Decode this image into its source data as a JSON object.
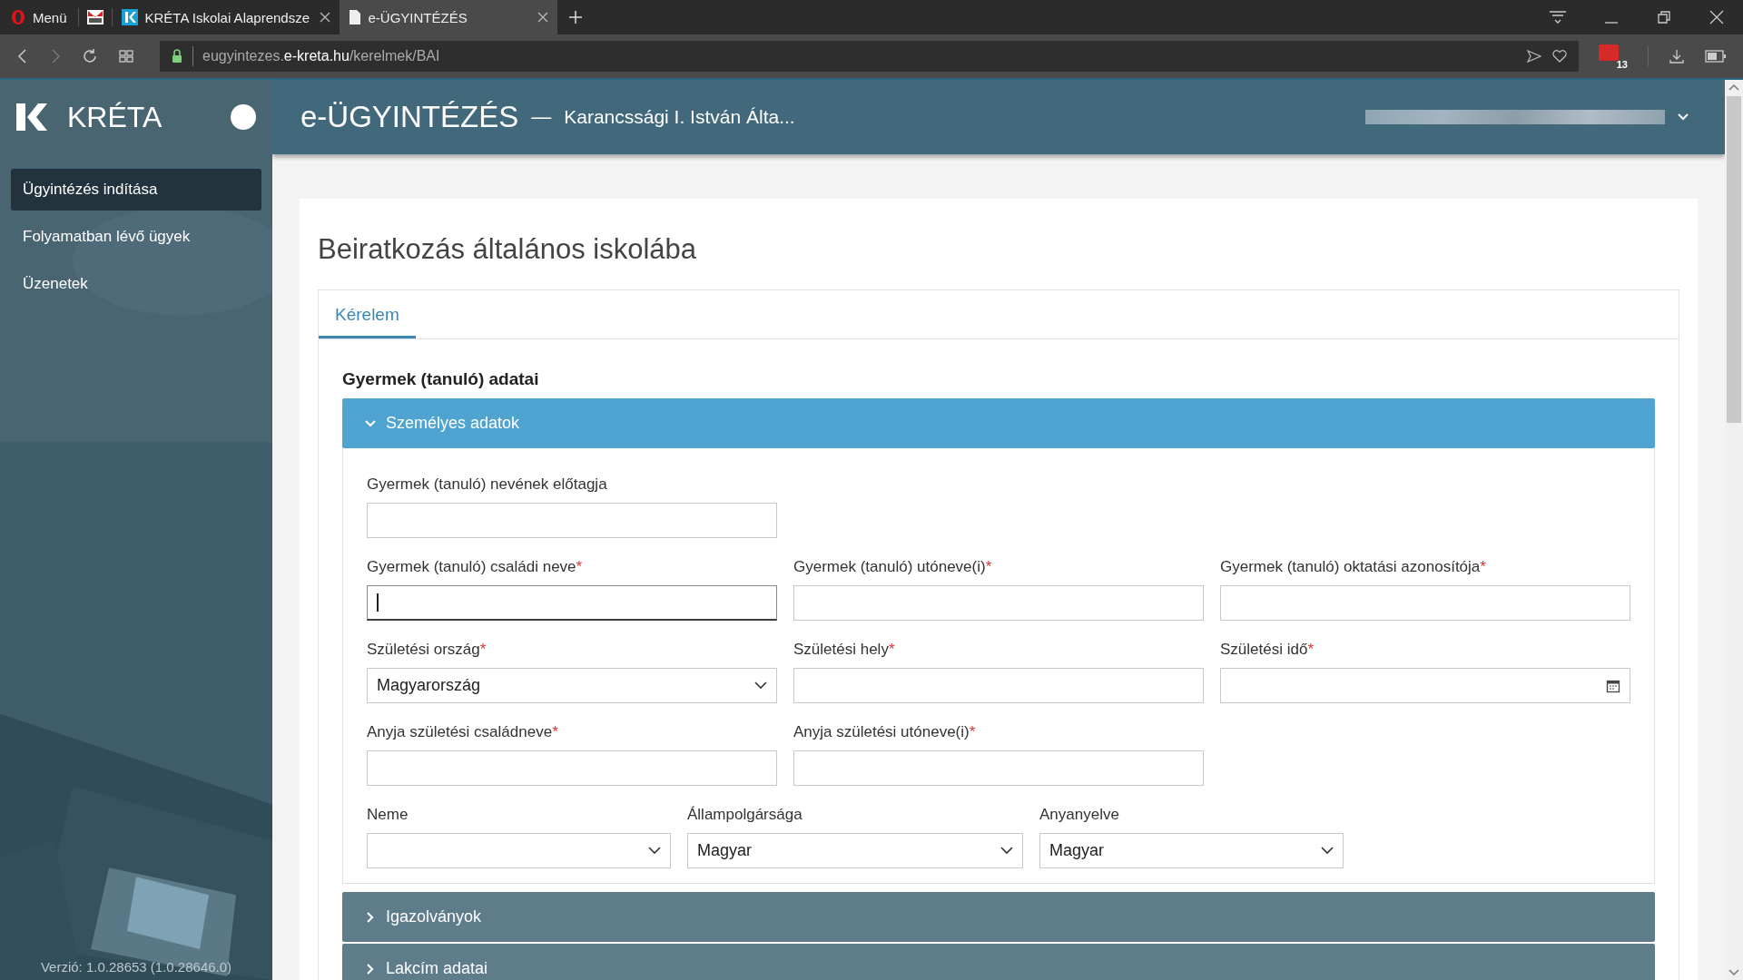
{
  "browser": {
    "menu": "Menü",
    "tabs": [
      {
        "kind": "pinned",
        "selected": false
      },
      {
        "label": "KRÉTA Iskolai Alaprendsze",
        "kind": "kreta",
        "selected": false
      },
      {
        "label": "e-ÜGYINTÉZÉS",
        "kind": "page",
        "selected": true
      }
    ],
    "url": {
      "prefix": "eugyintezes.",
      "domain": "e-kreta.hu",
      "path": "/kerelmek/BAI"
    },
    "badge": "13"
  },
  "sidebar": {
    "brand": "KRÉTA",
    "items": [
      {
        "label": "Ügyintézés indítása",
        "selected": true
      },
      {
        "label": "Folyamatban lévő ügyek",
        "selected": false
      },
      {
        "label": "Üzenetek",
        "selected": false
      }
    ],
    "version": "Verzió: 1.0.28653 (1.0.28646.0)"
  },
  "header": {
    "title": "e-ÜGYINTÉZÉS",
    "separator": "—",
    "school": "Karancssági I. István Álta..."
  },
  "page": {
    "title": "Beiratkozás általános iskolába",
    "tabs": [
      {
        "label": "Kérelem",
        "selected": true
      }
    ],
    "section_title": "Gyermek (tanuló) adatai",
    "required_mark": "*",
    "accordions": [
      {
        "title": "Személyes adatok",
        "expanded": true,
        "rows": [
          {
            "kind": "thirds",
            "fields": [
              {
                "label": "Gyermek (tanuló) nevének előtagja",
                "required": false,
                "kind": "text",
                "focused": false
              }
            ]
          },
          {
            "kind": "thirds",
            "fields": [
              {
                "label": "Gyermek (tanuló) családi neve",
                "required": true,
                "kind": "text",
                "focused": true
              },
              {
                "label": "Gyermek (tanuló) utóneve(i)",
                "required": true,
                "kind": "text",
                "focused": false
              },
              {
                "label": "Gyermek (tanuló) oktatási azonosítója",
                "required": true,
                "kind": "text",
                "focused": false
              }
            ]
          },
          {
            "kind": "thirds",
            "fields": [
              {
                "label": "Születési ország",
                "required": true,
                "kind": "select",
                "value": "Magyarország",
                "focused": false
              },
              {
                "label": "Születési hely",
                "required": true,
                "kind": "text",
                "focused": false
              },
              {
                "label": "Születési idő",
                "required": true,
                "kind": "date",
                "focused": false
              }
            ]
          },
          {
            "kind": "thirds",
            "fields": [
              {
                "label": "Anyja születési családneve",
                "required": true,
                "kind": "text",
                "focused": false
              },
              {
                "label": "Anyja születési utóneve(i)",
                "required": true,
                "kind": "text",
                "focused": false
              }
            ]
          },
          {
            "kind": "mixed",
            "fields": [
              {
                "label": "Neme",
                "required": false,
                "kind": "select",
                "focused": false
              },
              {
                "label": "Állampolgársága",
                "required": false,
                "kind": "select",
                "value": "Magyar",
                "focused": false
              },
              {
                "label": "Anyanyelve",
                "required": false,
                "kind": "select",
                "value": "Magyar",
                "focused": false
              }
            ]
          }
        ]
      },
      {
        "title": "Igazolványok",
        "expanded": false
      },
      {
        "title": "Lakcím adatai",
        "expanded": false
      }
    ]
  }
}
